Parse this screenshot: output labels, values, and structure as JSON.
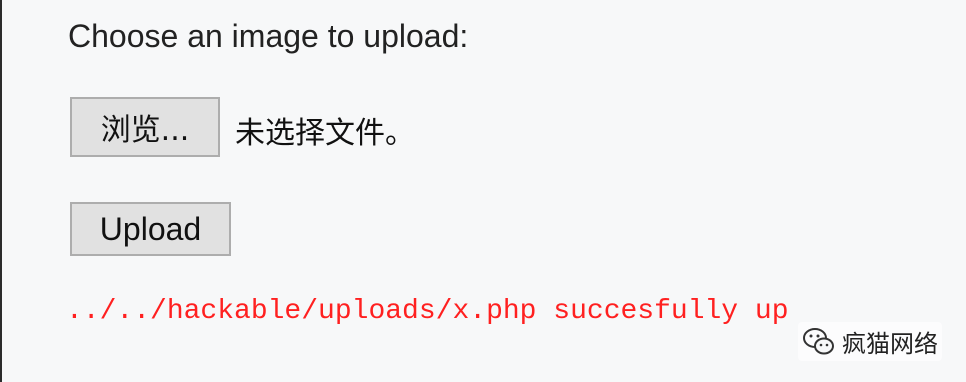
{
  "form": {
    "prompt": "Choose an image to upload:",
    "browse_label": "浏览...",
    "file_status": "未选择文件。",
    "upload_label": "Upload"
  },
  "result": {
    "message": "../../hackable/uploads/x.php succesfully up",
    "color": "#ff2020"
  },
  "watermark": {
    "icon": "wechat-icon",
    "text": "疯猫网络"
  }
}
